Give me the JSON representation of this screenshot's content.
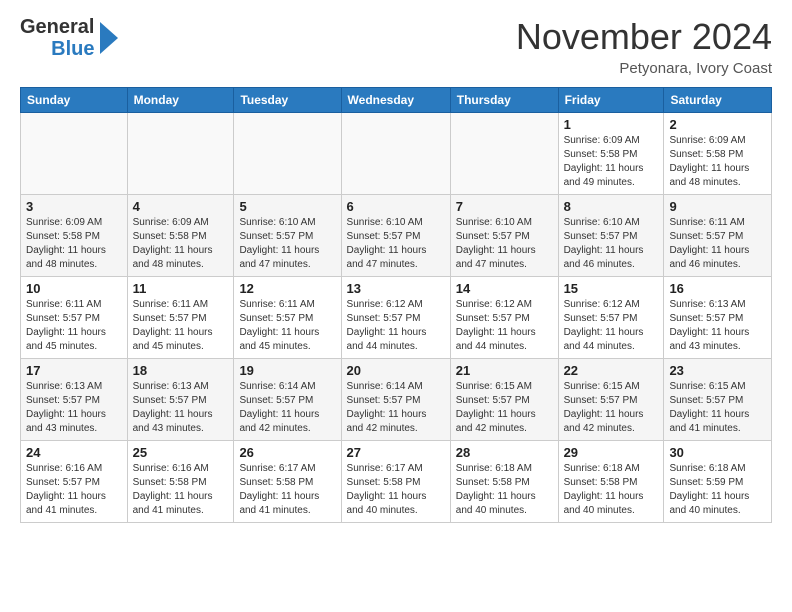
{
  "header": {
    "logo_general": "General",
    "logo_blue": "Blue",
    "month_title": "November 2024",
    "location": "Petyonara, Ivory Coast"
  },
  "weekdays": [
    "Sunday",
    "Monday",
    "Tuesday",
    "Wednesday",
    "Thursday",
    "Friday",
    "Saturday"
  ],
  "rows": [
    [
      {
        "day": "",
        "sunrise": "",
        "sunset": "",
        "daylight": "",
        "empty": true
      },
      {
        "day": "",
        "sunrise": "",
        "sunset": "",
        "daylight": "",
        "empty": true
      },
      {
        "day": "",
        "sunrise": "",
        "sunset": "",
        "daylight": "",
        "empty": true
      },
      {
        "day": "",
        "sunrise": "",
        "sunset": "",
        "daylight": "",
        "empty": true
      },
      {
        "day": "",
        "sunrise": "",
        "sunset": "",
        "daylight": "",
        "empty": true
      },
      {
        "day": "1",
        "sunrise": "Sunrise: 6:09 AM",
        "sunset": "Sunset: 5:58 PM",
        "daylight": "Daylight: 11 hours and 49 minutes.",
        "empty": false
      },
      {
        "day": "2",
        "sunrise": "Sunrise: 6:09 AM",
        "sunset": "Sunset: 5:58 PM",
        "daylight": "Daylight: 11 hours and 48 minutes.",
        "empty": false
      }
    ],
    [
      {
        "day": "3",
        "sunrise": "Sunrise: 6:09 AM",
        "sunset": "Sunset: 5:58 PM",
        "daylight": "Daylight: 11 hours and 48 minutes.",
        "empty": false
      },
      {
        "day": "4",
        "sunrise": "Sunrise: 6:09 AM",
        "sunset": "Sunset: 5:58 PM",
        "daylight": "Daylight: 11 hours and 48 minutes.",
        "empty": false
      },
      {
        "day": "5",
        "sunrise": "Sunrise: 6:10 AM",
        "sunset": "Sunset: 5:57 PM",
        "daylight": "Daylight: 11 hours and 47 minutes.",
        "empty": false
      },
      {
        "day": "6",
        "sunrise": "Sunrise: 6:10 AM",
        "sunset": "Sunset: 5:57 PM",
        "daylight": "Daylight: 11 hours and 47 minutes.",
        "empty": false
      },
      {
        "day": "7",
        "sunrise": "Sunrise: 6:10 AM",
        "sunset": "Sunset: 5:57 PM",
        "daylight": "Daylight: 11 hours and 47 minutes.",
        "empty": false
      },
      {
        "day": "8",
        "sunrise": "Sunrise: 6:10 AM",
        "sunset": "Sunset: 5:57 PM",
        "daylight": "Daylight: 11 hours and 46 minutes.",
        "empty": false
      },
      {
        "day": "9",
        "sunrise": "Sunrise: 6:11 AM",
        "sunset": "Sunset: 5:57 PM",
        "daylight": "Daylight: 11 hours and 46 minutes.",
        "empty": false
      }
    ],
    [
      {
        "day": "10",
        "sunrise": "Sunrise: 6:11 AM",
        "sunset": "Sunset: 5:57 PM",
        "daylight": "Daylight: 11 hours and 45 minutes.",
        "empty": false
      },
      {
        "day": "11",
        "sunrise": "Sunrise: 6:11 AM",
        "sunset": "Sunset: 5:57 PM",
        "daylight": "Daylight: 11 hours and 45 minutes.",
        "empty": false
      },
      {
        "day": "12",
        "sunrise": "Sunrise: 6:11 AM",
        "sunset": "Sunset: 5:57 PM",
        "daylight": "Daylight: 11 hours and 45 minutes.",
        "empty": false
      },
      {
        "day": "13",
        "sunrise": "Sunrise: 6:12 AM",
        "sunset": "Sunset: 5:57 PM",
        "daylight": "Daylight: 11 hours and 44 minutes.",
        "empty": false
      },
      {
        "day": "14",
        "sunrise": "Sunrise: 6:12 AM",
        "sunset": "Sunset: 5:57 PM",
        "daylight": "Daylight: 11 hours and 44 minutes.",
        "empty": false
      },
      {
        "day": "15",
        "sunrise": "Sunrise: 6:12 AM",
        "sunset": "Sunset: 5:57 PM",
        "daylight": "Daylight: 11 hours and 44 minutes.",
        "empty": false
      },
      {
        "day": "16",
        "sunrise": "Sunrise: 6:13 AM",
        "sunset": "Sunset: 5:57 PM",
        "daylight": "Daylight: 11 hours and 43 minutes.",
        "empty": false
      }
    ],
    [
      {
        "day": "17",
        "sunrise": "Sunrise: 6:13 AM",
        "sunset": "Sunset: 5:57 PM",
        "daylight": "Daylight: 11 hours and 43 minutes.",
        "empty": false
      },
      {
        "day": "18",
        "sunrise": "Sunrise: 6:13 AM",
        "sunset": "Sunset: 5:57 PM",
        "daylight": "Daylight: 11 hours and 43 minutes.",
        "empty": false
      },
      {
        "day": "19",
        "sunrise": "Sunrise: 6:14 AM",
        "sunset": "Sunset: 5:57 PM",
        "daylight": "Daylight: 11 hours and 42 minutes.",
        "empty": false
      },
      {
        "day": "20",
        "sunrise": "Sunrise: 6:14 AM",
        "sunset": "Sunset: 5:57 PM",
        "daylight": "Daylight: 11 hours and 42 minutes.",
        "empty": false
      },
      {
        "day": "21",
        "sunrise": "Sunrise: 6:15 AM",
        "sunset": "Sunset: 5:57 PM",
        "daylight": "Daylight: 11 hours and 42 minutes.",
        "empty": false
      },
      {
        "day": "22",
        "sunrise": "Sunrise: 6:15 AM",
        "sunset": "Sunset: 5:57 PM",
        "daylight": "Daylight: 11 hours and 42 minutes.",
        "empty": false
      },
      {
        "day": "23",
        "sunrise": "Sunrise: 6:15 AM",
        "sunset": "Sunset: 5:57 PM",
        "daylight": "Daylight: 11 hours and 41 minutes.",
        "empty": false
      }
    ],
    [
      {
        "day": "24",
        "sunrise": "Sunrise: 6:16 AM",
        "sunset": "Sunset: 5:57 PM",
        "daylight": "Daylight: 11 hours and 41 minutes.",
        "empty": false
      },
      {
        "day": "25",
        "sunrise": "Sunrise: 6:16 AM",
        "sunset": "Sunset: 5:58 PM",
        "daylight": "Daylight: 11 hours and 41 minutes.",
        "empty": false
      },
      {
        "day": "26",
        "sunrise": "Sunrise: 6:17 AM",
        "sunset": "Sunset: 5:58 PM",
        "daylight": "Daylight: 11 hours and 41 minutes.",
        "empty": false
      },
      {
        "day": "27",
        "sunrise": "Sunrise: 6:17 AM",
        "sunset": "Sunset: 5:58 PM",
        "daylight": "Daylight: 11 hours and 40 minutes.",
        "empty": false
      },
      {
        "day": "28",
        "sunrise": "Sunrise: 6:18 AM",
        "sunset": "Sunset: 5:58 PM",
        "daylight": "Daylight: 11 hours and 40 minutes.",
        "empty": false
      },
      {
        "day": "29",
        "sunrise": "Sunrise: 6:18 AM",
        "sunset": "Sunset: 5:58 PM",
        "daylight": "Daylight: 11 hours and 40 minutes.",
        "empty": false
      },
      {
        "day": "30",
        "sunrise": "Sunrise: 6:18 AM",
        "sunset": "Sunset: 5:59 PM",
        "daylight": "Daylight: 11 hours and 40 minutes.",
        "empty": false
      }
    ]
  ]
}
